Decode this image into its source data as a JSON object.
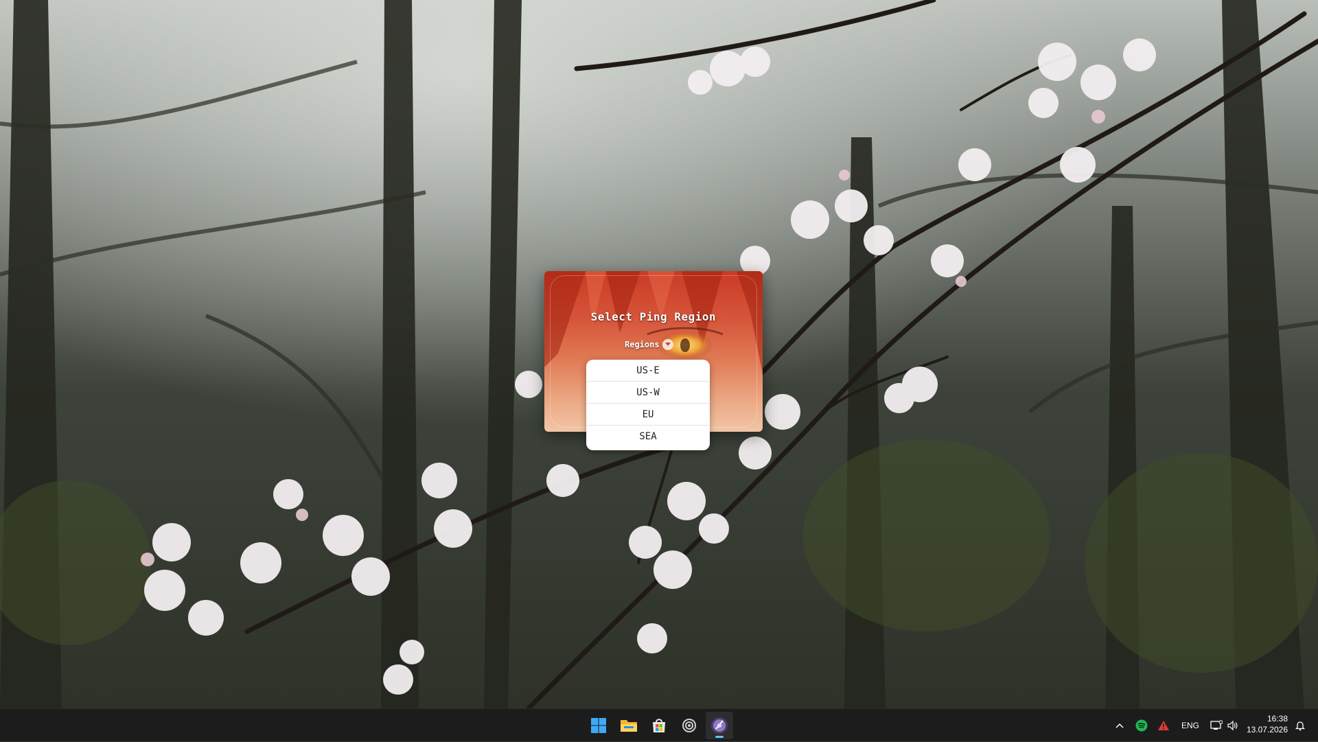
{
  "app": {
    "title": "Select Ping Region",
    "regions_label": "Regions",
    "options": [
      "US-E",
      "US-W",
      "EU",
      "SEA"
    ]
  },
  "taskbar": {
    "apps": [
      {
        "name": "Start",
        "icon": "windows-icon"
      },
      {
        "name": "File Explorer",
        "icon": "folder-icon"
      },
      {
        "name": "Microsoft Store",
        "icon": "store-icon"
      },
      {
        "name": "Settings",
        "icon": "gear-icon"
      },
      {
        "name": "Ping Region App",
        "icon": "app-icon",
        "active": true
      }
    ],
    "tray": {
      "language": "ENG",
      "time": "16:38",
      "date": "13.07.2026"
    }
  },
  "colors": {
    "taskbar_bg": "#1c1c1c",
    "accent": "#5cc8ff",
    "spotify": "#1db954",
    "warning": "#e03a3a",
    "app_red": "#c93a24"
  }
}
